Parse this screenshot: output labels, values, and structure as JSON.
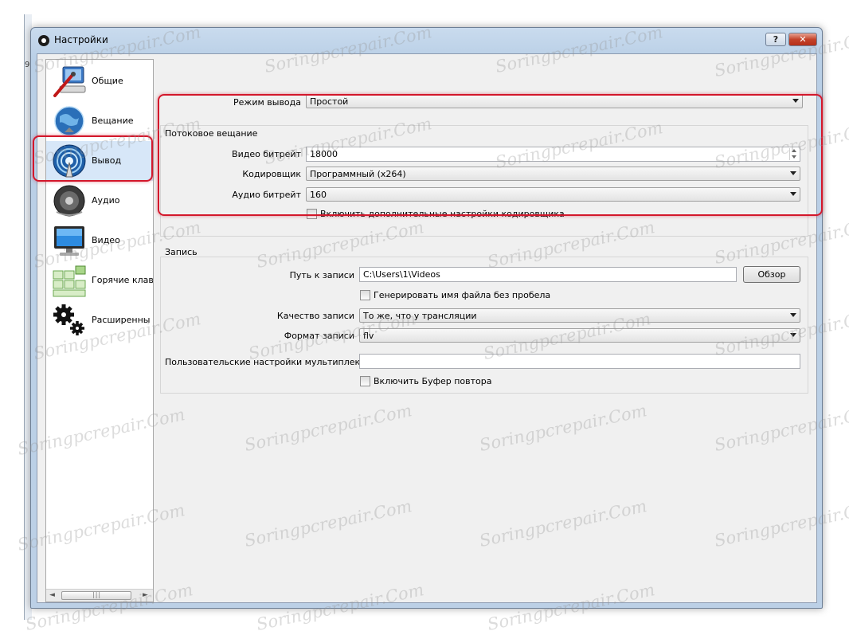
{
  "window": {
    "title": "Настройки",
    "help_label": "?",
    "close_label": "✕",
    "background_glyph": "9"
  },
  "sidebar": {
    "items": [
      {
        "label": "Общие",
        "icon": "general-settings-icon"
      },
      {
        "label": "Вещание",
        "icon": "globe-broadcast-icon"
      },
      {
        "label": "Вывод",
        "icon": "output-antenna-icon",
        "selected": true
      },
      {
        "label": "Аудио",
        "icon": "speaker-icon"
      },
      {
        "label": "Видео",
        "icon": "monitor-icon"
      },
      {
        "label": "Горячие клав",
        "icon": "hotkeys-icon"
      },
      {
        "label": "Расширенны",
        "icon": "gears-icon"
      }
    ],
    "scrollbar": {
      "left_arrow": "◄",
      "right_arrow": "►",
      "grip": "|||"
    }
  },
  "output": {
    "mode_label": "Режим вывода",
    "mode_value": "Простой"
  },
  "streaming": {
    "group_title": "Потоковое вещание",
    "video_bitrate_label": "Видео битрейт",
    "video_bitrate_value": "18000",
    "encoder_label": "Кодировщик",
    "encoder_value": "Программный (x264)",
    "audio_bitrate_label": "Аудио битрейт",
    "audio_bitrate_value": "160",
    "advanced_encoder_label": "Включить дополнительные настройки кодировщика"
  },
  "recording": {
    "group_title": "Запись",
    "path_label": "Путь к записи",
    "path_value": "C:\\Users\\1\\Videos",
    "browse_label": "Обзор",
    "no_space_label": "Генерировать имя файла без пробела",
    "quality_label": "Качество записи",
    "quality_value": "То же, что у трансляции",
    "format_label": "Формат записи",
    "format_value": "flv",
    "muxer_label": "Пользовательские настройки мультиплексора",
    "muxer_value": "",
    "replay_buffer_label": "Включить Буфер повтора"
  },
  "watermark": {
    "text": "Soringpcrepair.Com"
  },
  "colors": {
    "highlight": "#d3172b",
    "selected_bg": "#d7e7f8"
  }
}
